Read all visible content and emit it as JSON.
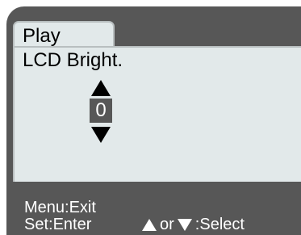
{
  "tab": {
    "label": "Play"
  },
  "setting": {
    "label": "LCD Bright.",
    "value": "0"
  },
  "footer": {
    "menu_hint": "Menu:Exit",
    "set_hint": "Set:Enter",
    "or_text": "or",
    "select_text": ":Select"
  },
  "icons": {
    "increase": "arrow-up-icon",
    "decrease": "arrow-down-icon"
  },
  "colors": {
    "screen_bg": "#575757",
    "panel_bg": "#e2e9ea",
    "panel_border": "#b9bfc0",
    "text_dark": "#000000",
    "text_light": "#ffffff"
  }
}
